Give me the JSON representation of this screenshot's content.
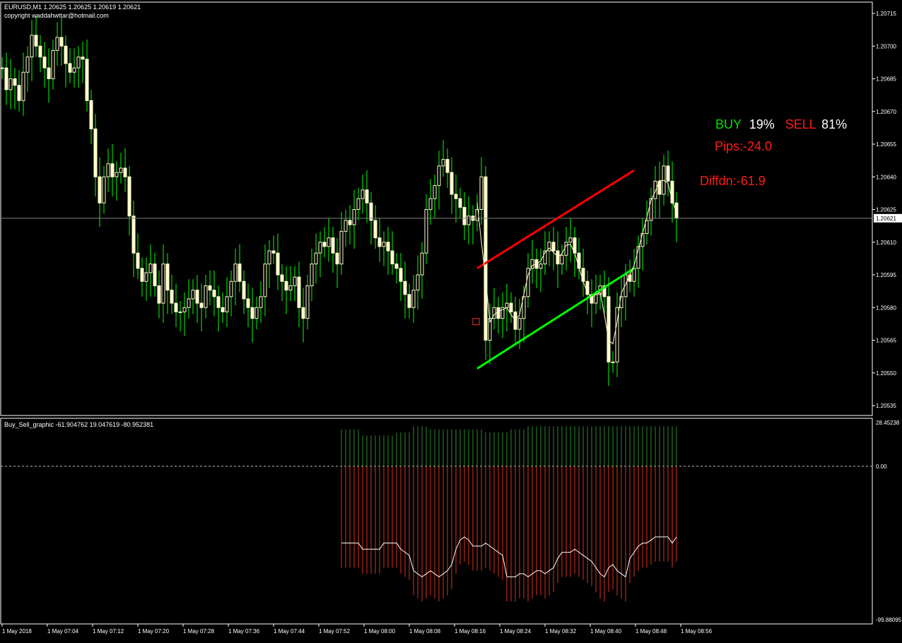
{
  "main_header": {
    "symbol_line": "EURUSD,M1  1.20625 1.20625 1.20619 1.20621",
    "copyright": "copyright waddahwttar@hotmail.com"
  },
  "panel_stats": {
    "buy_label": "BUY",
    "buy_pct": "19%",
    "sell_label": "SELL",
    "sell_pct": "81%",
    "pips": "Pips:-24.0",
    "diffdn": "Diffdn:-61.9"
  },
  "indicator_header": "Buy_Sell_graphic  -61.904762 19.047619 -80.952381",
  "colors": {
    "bull": "#ffffcc",
    "wick": "#00ff00",
    "upper_channel": "#ff0000",
    "lower_channel": "#00ff00",
    "buy_bar": "#2e8b2e",
    "sell_bar": "#e03020",
    "grid": "#808080"
  },
  "chart_data": [
    {
      "type": "candlestick",
      "symbol": "EURUSD",
      "timeframe": "M1",
      "ylim": [
        1.2053,
        1.2072
      ],
      "y_tick_labels": [
        "1.20715",
        "1.20700",
        "1.20685",
        "1.20670",
        "1.20655",
        "1.20640",
        "1.20625",
        "1.20610",
        "1.20595",
        "1.20580",
        "1.20565",
        "1.20550",
        "1.20535"
      ],
      "current_price": "1.20621",
      "x_tick_labels": [
        "1 May 2018",
        "1 May 07:04",
        "1 May 07:12",
        "1 May 07:20",
        "1 May 07:28",
        "1 May 07:36",
        "1 May 07:44",
        "1 May 07:52",
        "1 May 08:00",
        "1 May 08:08",
        "1 May 08:16",
        "1 May 08:24",
        "1 May 08:32",
        "1 May 08:40",
        "1 May 08:48",
        "1 May 08:56"
      ],
      "closes": [
        1.2069,
        1.2068,
        1.20685,
        1.20682,
        1.20675,
        1.20688,
        1.20695,
        1.20705,
        1.207,
        1.20695,
        1.2069,
        1.20685,
        1.20698,
        1.20704,
        1.207,
        1.20692,
        1.20688,
        1.2069,
        1.20695,
        1.20694,
        1.20675,
        1.20662,
        1.2064,
        1.20628,
        1.2064,
        1.20646,
        1.2064,
        1.20642,
        1.20644,
        1.2064,
        1.20622,
        1.20605,
        1.20598,
        1.20592,
        1.20596,
        1.206,
        1.2059,
        1.20582,
        1.206,
        1.20588,
        1.20582,
        1.20578,
        1.20578,
        1.2058,
        1.20584,
        1.20588,
        1.20582,
        1.2058,
        1.2059,
        1.20588,
        1.20585,
        1.2058,
        1.20578,
        1.20585,
        1.20592,
        1.206,
        1.20592,
        1.20584,
        1.2058,
        1.20575,
        1.2058,
        1.20585,
        1.206,
        1.20606,
        1.20605,
        1.20595,
        1.20592,
        1.20588,
        1.2059,
        1.20594,
        1.2058,
        1.20575,
        1.2059,
        1.206,
        1.20605,
        1.2061,
        1.20608,
        1.20612,
        1.20605,
        1.206,
        1.20615,
        1.2062,
        1.20618,
        1.20625,
        1.2063,
        1.20634,
        1.20628,
        1.2062,
        1.20612,
        1.20608,
        1.2061,
        1.20606,
        1.206,
        1.20598,
        1.20592,
        1.20586,
        1.2058,
        1.20588,
        1.20595,
        1.20605,
        1.20625,
        1.2063,
        1.20636,
        1.20645,
        1.20648,
        1.20642,
        1.20632,
        1.2063,
        1.20626,
        1.20618,
        1.20622,
        1.2062,
        1.20625,
        1.2064,
        1.20565,
        1.20575,
        1.2058,
        1.20575,
        1.2058,
        1.20582,
        1.20578,
        1.2057,
        1.20575,
        1.20585,
        1.20598,
        1.20602,
        1.20598,
        1.206,
        1.20606,
        1.2061,
        1.20606,
        1.206,
        1.20604,
        1.2061,
        1.20612,
        1.20605,
        1.20598,
        1.20592,
        1.20586,
        1.20582,
        1.20586,
        1.2059,
        1.20585,
        1.20555,
        1.20555,
        1.2058,
        1.20585,
        1.20595,
        1.20592,
        1.20598,
        1.20608,
        1.20614,
        1.2062,
        1.2063,
        1.20638,
        1.20632,
        1.20645,
        1.20638,
        1.20628,
        1.20621
      ],
      "channel_upper": {
        "from": [
          1.20598,
          112
        ],
        "to": [
          1.20643,
          149
        ]
      },
      "channel_lower": {
        "from": [
          1.20552,
          112
        ],
        "to": [
          1.20598,
          149
        ]
      }
    },
    {
      "type": "bar",
      "name": "Buy_Sell_graphic",
      "ylim": [
        -99.88095,
        28.45238
      ],
      "y_tick_labels": [
        "28.45238",
        "0.00",
        "-99.88095"
      ],
      "buy_values": [
        24,
        24,
        24,
        24,
        24,
        20,
        20,
        20,
        20,
        20,
        20,
        20,
        20,
        22,
        22,
        22,
        22,
        26,
        26,
        26,
        26,
        24,
        24,
        24,
        24,
        24,
        24,
        24,
        24,
        24,
        24,
        24,
        24,
        24,
        22,
        22,
        22,
        22,
        22,
        22,
        24,
        24,
        24,
        24,
        26,
        26,
        26,
        26,
        26,
        26,
        26,
        26,
        26,
        26,
        26,
        26,
        26,
        26,
        26,
        26,
        26,
        26,
        26,
        26,
        26,
        26,
        26,
        26,
        26,
        26,
        26,
        26,
        26,
        26,
        26,
        26,
        26,
        26,
        26,
        26
      ],
      "sell_values": [
        -66,
        -66,
        -66,
        -66,
        -66,
        -70,
        -70,
        -70,
        -70,
        -70,
        -66,
        -66,
        -66,
        -66,
        -70,
        -72,
        -74,
        -84,
        -86,
        -88,
        -86,
        -84,
        -86,
        -88,
        -86,
        -84,
        -80,
        -70,
        -64,
        -62,
        -64,
        -68,
        -68,
        -68,
        -66,
        -68,
        -70,
        -72,
        -74,
        -88,
        -88,
        -88,
        -86,
        -86,
        -88,
        -86,
        -84,
        -84,
        -86,
        -84,
        -82,
        -76,
        -72,
        -72,
        -72,
        -70,
        -72,
        -74,
        -76,
        -78,
        -82,
        -86,
        -88,
        -82,
        -80,
        -84,
        -86,
        -88,
        -76,
        -72,
        -68,
        -66,
        -66,
        -64,
        -62,
        -62,
        -62,
        -62,
        -66,
        -62
      ]
    }
  ]
}
